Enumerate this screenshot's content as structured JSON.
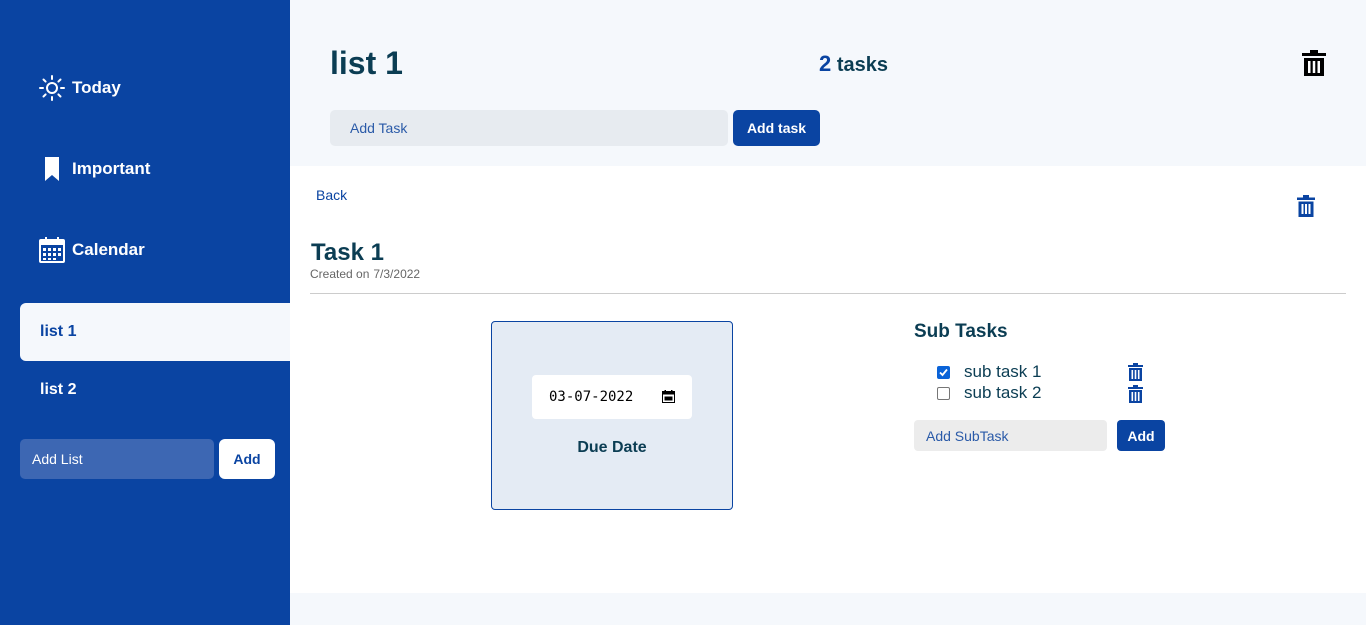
{
  "sidebar": {
    "nav": [
      {
        "label": "Today",
        "icon": "sun-icon"
      },
      {
        "label": "Important",
        "icon": "bookmark-icon"
      },
      {
        "label": "Calendar",
        "icon": "calendar-icon"
      }
    ],
    "lists": [
      {
        "label": "list 1",
        "active": true
      },
      {
        "label": "list 2",
        "active": false
      }
    ],
    "add_list": {
      "placeholder": "Add List",
      "button_label": "Add"
    }
  },
  "header": {
    "title": "list 1",
    "task_count": "2",
    "task_count_suffix": "tasks",
    "add_task": {
      "placeholder": "Add Task",
      "button_label": "Add task"
    }
  },
  "detail": {
    "back_label": "Back",
    "task_title": "Task 1",
    "created_label": "Created on",
    "created_date": "7/3/2022",
    "due_date_value": "03-07-2022",
    "due_date_label": "Due Date",
    "subtasks_title": "Sub Tasks",
    "subtasks": [
      {
        "label": "sub task 1",
        "checked": true
      },
      {
        "label": "sub task 2",
        "checked": false
      }
    ],
    "add_subtask": {
      "placeholder": "Add SubTask",
      "button_label": "Add"
    }
  },
  "colors": {
    "primary": "#0a44a2",
    "title_text": "#0b3d53",
    "background": "#f5f8fc"
  }
}
